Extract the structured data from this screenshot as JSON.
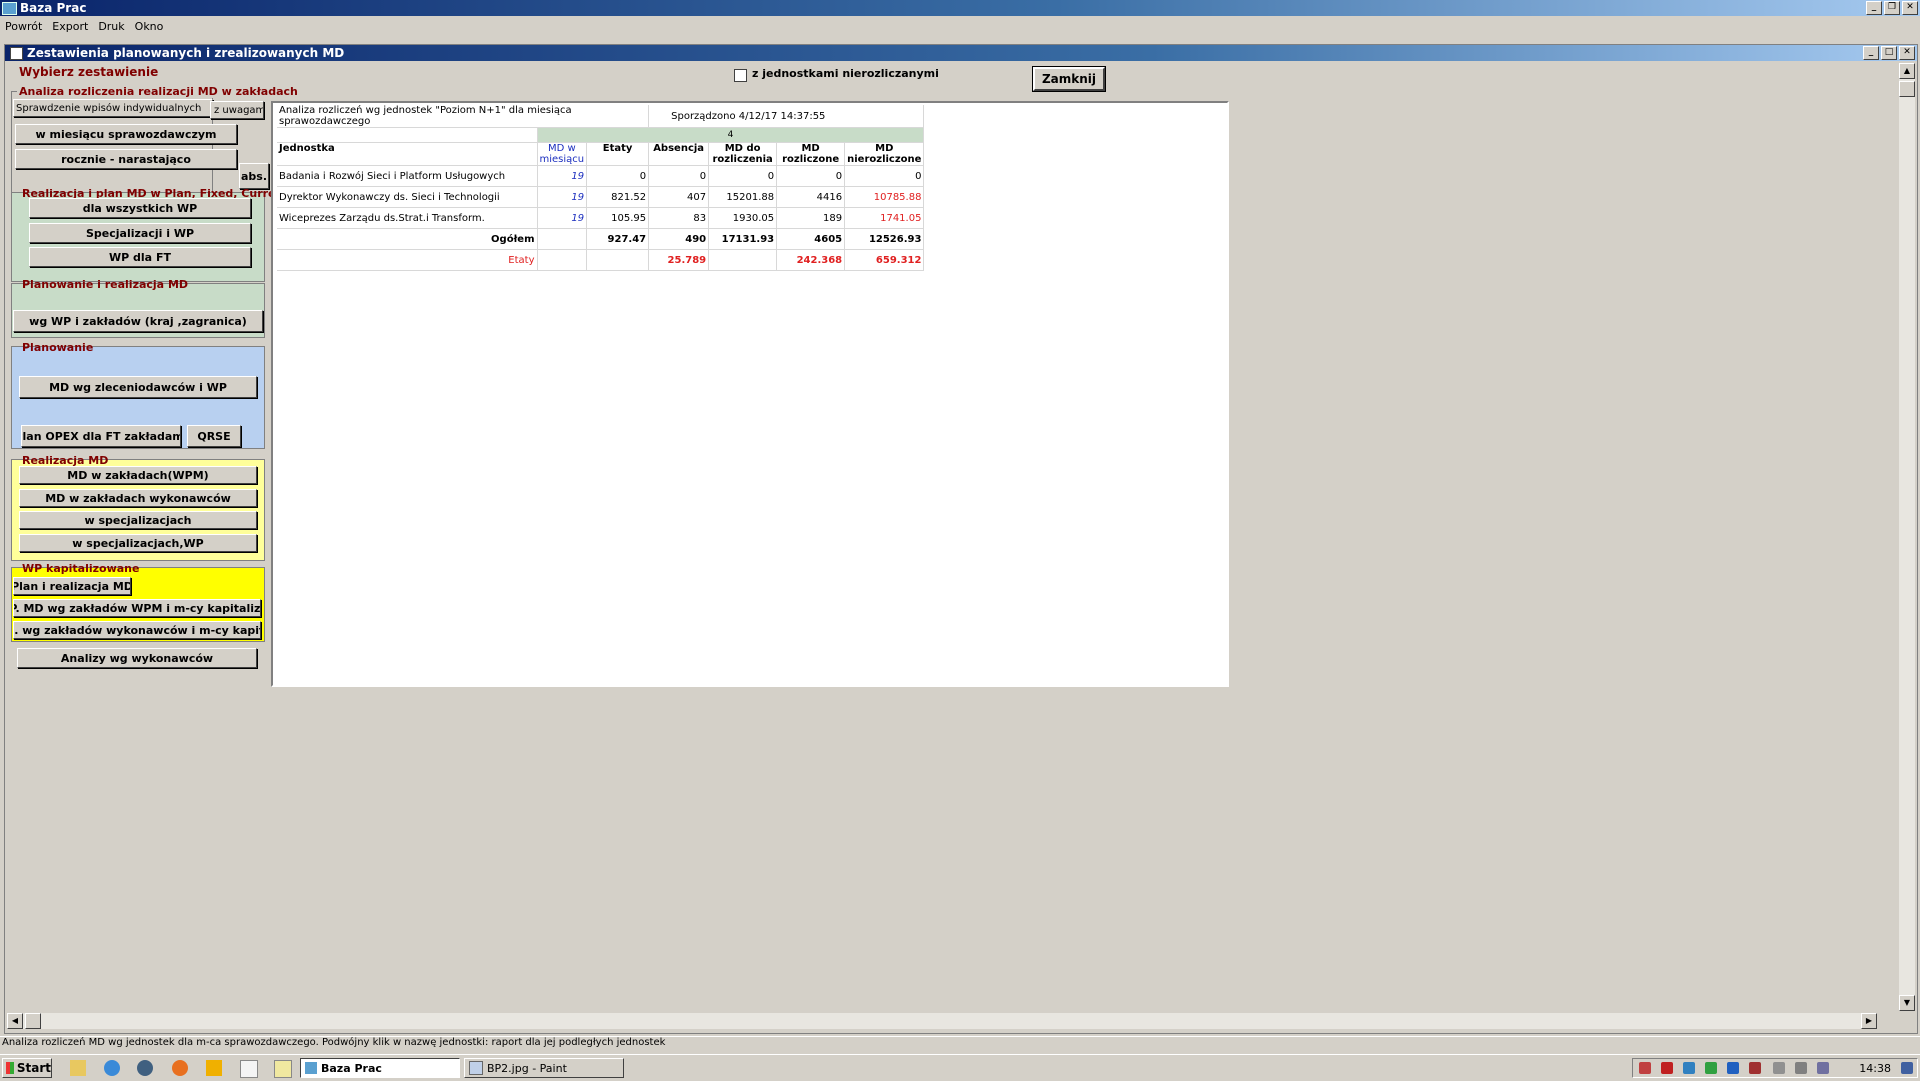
{
  "app": {
    "title": "Baza Prac"
  },
  "menu": [
    "Powrót",
    "Export",
    "Druk",
    "Okno"
  ],
  "window": {
    "title": "Zestawienia planowanych i zrealizowanych MD"
  },
  "left": {
    "wybierz": "Wybierz zestawienie",
    "g1": {
      "title": "Analiza rozliczenia realizacji MD w zakładach",
      "btn_sprawdzenie": "Sprawdzenie wpisów  indywidualnych",
      "btn_zuwagami": "z uwagami",
      "btn_miesiac": "w miesiącu sprawozdawczym",
      "btn_rocznie": "rocznie - narastająco",
      "btn_abs": "abs."
    },
    "g2": {
      "title": "Realizacja i plan MD w Plan, Fixed, Current",
      "btn1": "dla wszystkich WP",
      "btn2": "Specjalizacji i WP",
      "btn3": "WP dla FT"
    },
    "g3": {
      "title": "Planowanie i realizacja MD",
      "btn1": "wg WP i zakładów (kraj ,zagranica)"
    },
    "g4": {
      "title": "Planowanie",
      "btn1": "MD wg zleceniodawców i  WP",
      "btn2": "Plan OPEX dla FT zakładami",
      "btn3": "QRSE"
    },
    "g5": {
      "title": "Realizacja MD",
      "btn1": "MD w zakładach(WPM)",
      "btn2": "MD w zakładach wykonawców",
      "btn3": "w specjalizacjach",
      "btn4": "w specjalizacjach,WP"
    },
    "g6": {
      "title": "WP kapitalizowane",
      "btn1": "Plan i realizacja MD",
      "btn2": "P. MD wg zakładów WPM i m-cy kapitaliz.",
      "btn3": "R. wg zakładów wykonawców i m-cy kapit."
    },
    "btn_analizy": "Analizy wg wykonawców"
  },
  "checkbox_label": "z jednostkami nierozliczanymi",
  "close_button": "Zamknij",
  "report": {
    "title": "Analiza rozliczeń wg jednostek \"Poziom N+1\" dla miesiąca sprawozdawczego",
    "date": "Sporządzono 4/12/17 14:37:55",
    "band": "4",
    "headers": {
      "jednostka": "Jednostka",
      "md_w": "MD w",
      "miesiacu": "miesiącu",
      "etaty": "Etaty",
      "absencja": "Absencja",
      "md_do": "MD do",
      "rozliczenia": "rozliczenia",
      "md_roz1": "MD",
      "md_roz2": "rozliczone",
      "md_nie1": "MD",
      "md_nie2": "nierozliczone"
    },
    "rows": [
      {
        "name": "Badania i Rozwój Sieci i Platform Usługowych",
        "md": "19",
        "etaty": "0",
        "absencja": "0",
        "do": "0",
        "roz": "0",
        "nie": "0"
      },
      {
        "name": "Dyrektor Wykonawczy ds. Sieci i Technologii",
        "md": "19",
        "etaty": "821.52",
        "absencja": "407",
        "do": "15201.88",
        "roz": "4416",
        "nie": "10785.88"
      },
      {
        "name": "Wiceprezes Zarządu ds.Strat.i Transform.",
        "md": "19",
        "etaty": "105.95",
        "absencja": "83",
        "do": "1930.05",
        "roz": "189",
        "nie": "1741.05"
      }
    ],
    "total": {
      "label": "Ogółem",
      "etaty": "927.47",
      "absencja": "490",
      "do": "17131.93",
      "roz": "4605",
      "nie": "12526.93"
    },
    "etaty_row": {
      "label": "Etaty",
      "absencja": "25.789",
      "roz": "242.368",
      "nie": "659.312"
    }
  },
  "status": "Analiza rozliczeń MD wg jednostek dla m-ca sprawozdawczego. Podwójny klik w nazwę jednostki: raport dla jej podległych jednostek",
  "taskbar": {
    "start": "Start",
    "task1": "Baza Prac",
    "task2": "BP2.jpg - Paint",
    "time": "14:38"
  }
}
